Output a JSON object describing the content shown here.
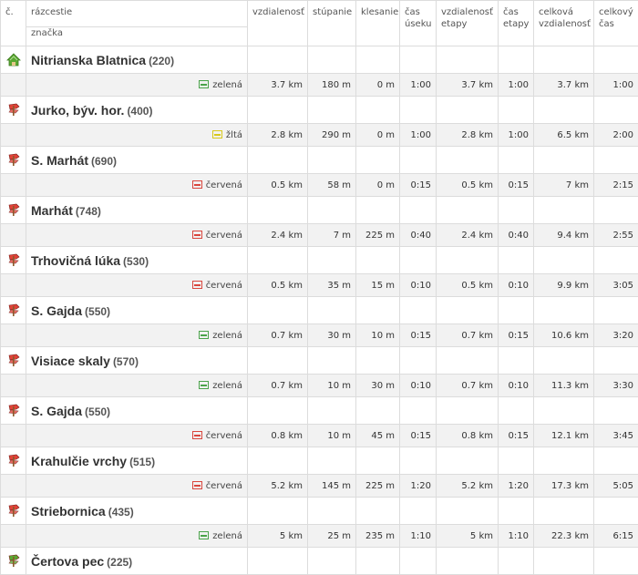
{
  "header": {
    "col_no": "č.",
    "col_crossroad": "rázcestie",
    "col_marking": "značka",
    "col_distance": "vzdialenosť",
    "col_ascent": "stúpanie",
    "col_descent": "klesanie",
    "col_seg_time": "čas úseku",
    "col_stage_distance": "vzdialenosť etapy",
    "col_stage_time": "čas etapy",
    "col_total_distance": "celková vzdialenosť",
    "col_total_time": "celkový čas"
  },
  "colors": {
    "zelena": "#4aa34a",
    "zlta": "#d8c81c",
    "cervena": "#d9463d",
    "start_icon": "#5aa832",
    "waypoint_icon": "#e04238",
    "end_icon": "#5aa832"
  },
  "places": [
    {
      "name": "Nitrianska Blatnica",
      "alt": "(220)",
      "icon": "house-icon"
    },
    {
      "name": "Jurko, býv. hor.",
      "alt": "(400)",
      "icon": "signpost-icon"
    },
    {
      "name": "S. Marhát",
      "alt": "(690)",
      "icon": "signpost-icon"
    },
    {
      "name": "Marhát",
      "alt": "(748)",
      "icon": "signpost-icon"
    },
    {
      "name": "Trhovičná lúka",
      "alt": "(530)",
      "icon": "signpost-icon"
    },
    {
      "name": "S. Gajda",
      "alt": "(550)",
      "icon": "signpost-icon"
    },
    {
      "name": "Visiace skaly",
      "alt": "(570)",
      "icon": "signpost-icon"
    },
    {
      "name": "S. Gajda",
      "alt": "(550)",
      "icon": "signpost-icon"
    },
    {
      "name": "Krahulčie vrchy",
      "alt": "(515)",
      "icon": "signpost-icon"
    },
    {
      "name": "Striebornica",
      "alt": "(435)",
      "icon": "signpost-icon"
    },
    {
      "name": "Čertova pec",
      "alt": "(225)",
      "icon": "signpost-end-icon"
    }
  ],
  "segments": [
    {
      "mark": "zelená",
      "color_key": "zelena",
      "dist": "3.7 km",
      "up": "180 m",
      "down": "0 m",
      "time": "1:00",
      "stage_dist": "3.7 km",
      "stage_time": "1:00",
      "total_dist": "3.7 km",
      "total_time": "1:00"
    },
    {
      "mark": "žltá",
      "color_key": "zlta",
      "dist": "2.8 km",
      "up": "290 m",
      "down": "0 m",
      "time": "1:00",
      "stage_dist": "2.8 km",
      "stage_time": "1:00",
      "total_dist": "6.5 km",
      "total_time": "2:00"
    },
    {
      "mark": "červená",
      "color_key": "cervena",
      "dist": "0.5 km",
      "up": "58 m",
      "down": "0 m",
      "time": "0:15",
      "stage_dist": "0.5 km",
      "stage_time": "0:15",
      "total_dist": "7 km",
      "total_time": "2:15"
    },
    {
      "mark": "červená",
      "color_key": "cervena",
      "dist": "2.4 km",
      "up": "7 m",
      "down": "225 m",
      "time": "0:40",
      "stage_dist": "2.4 km",
      "stage_time": "0:40",
      "total_dist": "9.4 km",
      "total_time": "2:55"
    },
    {
      "mark": "červená",
      "color_key": "cervena",
      "dist": "0.5 km",
      "up": "35 m",
      "down": "15 m",
      "time": "0:10",
      "stage_dist": "0.5 km",
      "stage_time": "0:10",
      "total_dist": "9.9 km",
      "total_time": "3:05"
    },
    {
      "mark": "zelená",
      "color_key": "zelena",
      "dist": "0.7 km",
      "up": "30 m",
      "down": "10 m",
      "time": "0:15",
      "stage_dist": "0.7 km",
      "stage_time": "0:15",
      "total_dist": "10.6 km",
      "total_time": "3:20"
    },
    {
      "mark": "zelená",
      "color_key": "zelena",
      "dist": "0.7 km",
      "up": "10 m",
      "down": "30 m",
      "time": "0:10",
      "stage_dist": "0.7 km",
      "stage_time": "0:10",
      "total_dist": "11.3 km",
      "total_time": "3:30"
    },
    {
      "mark": "červená",
      "color_key": "cervena",
      "dist": "0.8 km",
      "up": "10 m",
      "down": "45 m",
      "time": "0:15",
      "stage_dist": "0.8 km",
      "stage_time": "0:15",
      "total_dist": "12.1 km",
      "total_time": "3:45"
    },
    {
      "mark": "červená",
      "color_key": "cervena",
      "dist": "5.2 km",
      "up": "145 m",
      "down": "225 m",
      "time": "1:20",
      "stage_dist": "5.2 km",
      "stage_time": "1:20",
      "total_dist": "17.3 km",
      "total_time": "5:05"
    },
    {
      "mark": "zelená",
      "color_key": "zelena",
      "dist": "5 km",
      "up": "25 m",
      "down": "235 m",
      "time": "1:10",
      "stage_dist": "5 km",
      "stage_time": "1:10",
      "total_dist": "22.3 km",
      "total_time": "6:15"
    }
  ]
}
